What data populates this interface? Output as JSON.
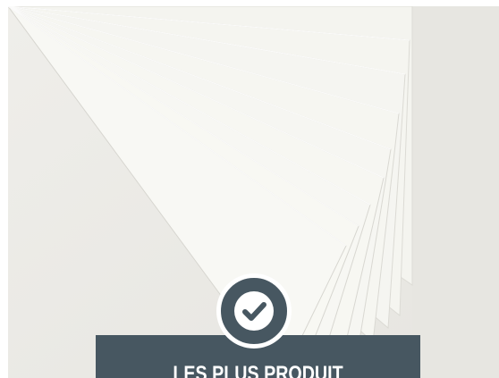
{
  "banner": {
    "title": "LES PLUS PRODUIT"
  },
  "badge": {
    "icon": "checkmark-icon"
  },
  "colors": {
    "banner_background": "#475761",
    "badge_background": "#475761",
    "badge_border": "#ffffff",
    "photo_background": "#ecebe6",
    "paper": "#f5f5f0"
  }
}
